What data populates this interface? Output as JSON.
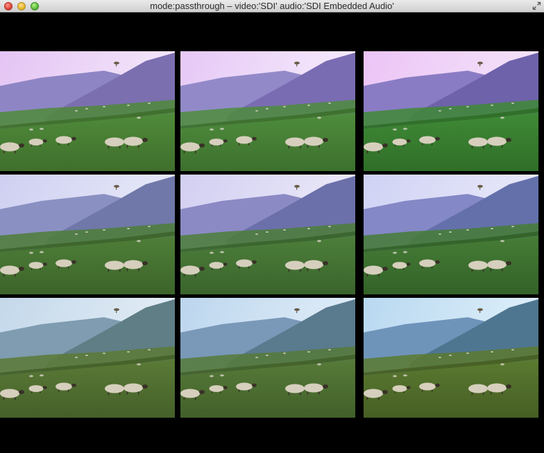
{
  "window": {
    "title": "mode:passthrough – video:'SDI' audio:'SDI Embedded Audio'"
  },
  "grid": {
    "rows": 3,
    "columns": 3,
    "tiles": [
      {
        "sky_top": "#e4c4f4",
        "sky_bottom": "#f4e8fa",
        "hill": "#7c6fb0",
        "far_hill": "#8e86c4",
        "grass": "#4f8a3a",
        "grass_dark": "#3f6f2c"
      },
      {
        "sky_top": "#e6c8f6",
        "sky_bottom": "#f6ecfc",
        "hill": "#7a6cb2",
        "far_hill": "#928ac8",
        "grass": "#4e8c3c",
        "grass_dark": "#3d702e"
      },
      {
        "sky_top": "#ecc4f6",
        "sky_bottom": "#f4e4fa",
        "hill": "#6e62aa",
        "far_hill": "#8a7cc4",
        "grass": "#3f8a36",
        "grass_dark": "#2f6e28"
      },
      {
        "sky_top": "#cfd0f2",
        "sky_bottom": "#e8eaf8",
        "hill": "#6f78a8",
        "far_hill": "#8a90c2",
        "grass": "#4e7e38",
        "grass_dark": "#3c642a"
      },
      {
        "sky_top": "#d2cff2",
        "sky_bottom": "#eceaf8",
        "hill": "#6c70aa",
        "far_hill": "#8c8ac4",
        "grass": "#4c7e3a",
        "grass_dark": "#3a642c"
      },
      {
        "sky_top": "#cfd2f4",
        "sky_bottom": "#eaeafa",
        "hill": "#6470aa",
        "far_hill": "#8488c6",
        "grass": "#457c36",
        "grass_dark": "#336228"
      },
      {
        "sky_top": "#c4d8ea",
        "sky_bottom": "#e4eef6",
        "hill": "#5f7e86",
        "far_hill": "#7f9cb0",
        "grass": "#5a7a36",
        "grass_dark": "#45602a"
      },
      {
        "sky_top": "#bcd6ee",
        "sky_bottom": "#e2eef8",
        "hill": "#5a7a8e",
        "far_hill": "#7a98b8",
        "grass": "#567a38",
        "grass_dark": "#42602a"
      },
      {
        "sky_top": "#b8d8f0",
        "sky_bottom": "#e0f0fa",
        "hill": "#4f7690",
        "far_hill": "#6f94ba",
        "grass": "#5a7a30",
        "grass_dark": "#465e24"
      }
    ]
  }
}
